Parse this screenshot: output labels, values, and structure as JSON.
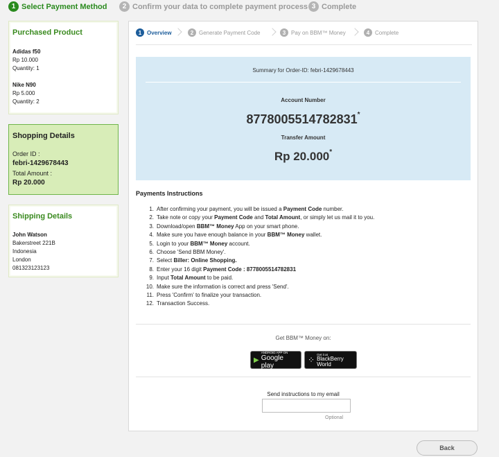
{
  "top_steps": [
    {
      "num": "1",
      "label": "Select Payment Method"
    },
    {
      "num": "2",
      "label": "Confirm your data to complete payment process"
    },
    {
      "num": "3",
      "label": "Complete"
    }
  ],
  "purchased": {
    "title": "Purchased Product",
    "items": [
      {
        "name": "Adidas f50",
        "price": "Rp 10.000",
        "qty": "Quantity: 1"
      },
      {
        "name": "Nike N90",
        "price": "Rp 5.000",
        "qty": "Quantity: 2"
      }
    ]
  },
  "shopping": {
    "title": "Shopping Details",
    "order_label": "Order ID :",
    "order_id": "febri-1429678443",
    "total_label": "Total Amount :",
    "total": "Rp 20.000"
  },
  "shipping": {
    "title": "Shipping Details",
    "name": "John Watson",
    "address": "Bakerstreet 221B",
    "country": "Indonesia",
    "city": "London",
    "phone": "081323123123"
  },
  "sub_steps": [
    {
      "num": "1",
      "label": "Overview"
    },
    {
      "num": "2",
      "label": "Generate Payment Code"
    },
    {
      "num": "3",
      "label": "Pay on BBM™ Money"
    },
    {
      "num": "4",
      "label": "Complete"
    }
  ],
  "summary": {
    "heading": "Summary for Order-ID: febri-1429678443",
    "account_label": "Account Number",
    "account_number": "8778005514782831",
    "amount_label": "Transfer Amount",
    "amount": "Rp 20.000",
    "asterisk": "*"
  },
  "instructions": {
    "title": "Payments Instructions",
    "n1": "1.",
    "i1a": "After confirming your payment, you will be issued a ",
    "i1b": "Payment Code",
    "i1c": " number.",
    "n2": "2.",
    "i2a": "Take note or copy your ",
    "i2b": "Payment Code",
    "i2c": " and ",
    "i2d": "Total Amount",
    "i2e": ", or simply let us mail it to you.",
    "n3": "3.",
    "i3a": "Download/open ",
    "i3b": "BBM™ Money",
    "i3c": " App on your smart phone.",
    "n4": "4.",
    "i4a": "Make sure you have enough balance in your ",
    "i4b": "BBM™ Money",
    "i4c": " wallet.",
    "n5": "5.",
    "i5a": "Login to your ",
    "i5b": "BBM™ Money",
    "i5c": " account.",
    "n6": "6.",
    "i6a": "Choose 'Send BBM Money'.",
    "n7": "7.",
    "i7a": "Select ",
    "i7b": "Biller: Online Shopping.",
    "n8": "8.",
    "i8a": "Enter your 16 digit ",
    "i8b": "Payment Code : 8778005514782831",
    "n9": "9.",
    "i9a": "Input ",
    "i9b": "Total Amount",
    "i9c": " to be paid.",
    "n10": "10.",
    "i10a": "Make sure the information is correct and press 'Send'.",
    "n11": "11.",
    "i11a": "Press 'Confirm' to finalize your transaction.",
    "n12": "12.",
    "i12a": "Transaction Success."
  },
  "get_bbm": {
    "label": "Get BBM™ Money on:",
    "google_small": "ANDROID APP ON",
    "google_big": "Google play",
    "bb_small": "Get it at",
    "bb_big1": "BlackBerry",
    "bb_big2": "World"
  },
  "email": {
    "label": "Send instructions to my email",
    "value": "",
    "optional": "Optional"
  },
  "back_button": "Back",
  "colors": {
    "accent_green": "#2a8a1e",
    "accent_blue": "#1d5d9b",
    "summary_bg": "#d7eaf5",
    "shopping_bg": "#d8edb8"
  }
}
